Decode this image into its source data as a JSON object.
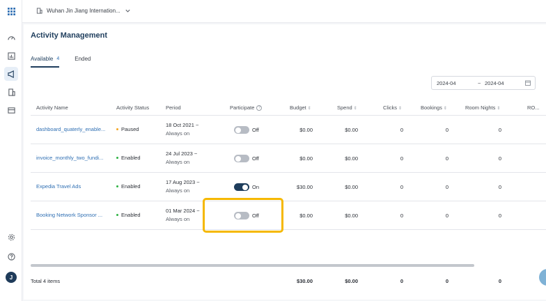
{
  "header": {
    "hotel_name": "Wuhan Jin Jiang Internation..."
  },
  "rail": {
    "avatar_initial": "J"
  },
  "page": {
    "title": "Activity Management"
  },
  "tabs": [
    {
      "label": "Available",
      "count": "4"
    },
    {
      "label": "Ended"
    }
  ],
  "date_range": {
    "start": "2024-04",
    "separator": "~",
    "end": "2024-04"
  },
  "table": {
    "columns": {
      "name": "Activity Name",
      "status": "Activity Status",
      "period": "Period",
      "participate": "Participate",
      "budget": "Budget",
      "spend": "Spend",
      "clicks": "Clicks",
      "bookings": "Bookings",
      "room_nights": "Room Nights",
      "roas": "RO..."
    },
    "rows": [
      {
        "name": "dashboard_quaterly_enable...",
        "status": "Paused",
        "status_color": "#f5a623",
        "period_start": "18 Oct 2021 ~",
        "period_end": "Always on",
        "participate": "Off",
        "budget": "$0.00",
        "spend": "$0.00",
        "clicks": "0",
        "bookings": "0",
        "room_nights": "0"
      },
      {
        "name": "invoice_monthly_two_fundi...",
        "status": "Enabled",
        "status_color": "#2fb344",
        "period_start": "24 Jul 2023 ~",
        "period_end": "Always on",
        "participate": "Off",
        "budget": "$0.00",
        "spend": "$0.00",
        "clicks": "0",
        "bookings": "0",
        "room_nights": "0"
      },
      {
        "name": "Expedia Travel Ads",
        "status": "Enabled",
        "status_color": "#2fb344",
        "period_start": "17 Aug 2023 ~",
        "period_end": "Always on",
        "participate": "On",
        "budget": "$30.00",
        "spend": "$0.00",
        "clicks": "0",
        "bookings": "0",
        "room_nights": "0"
      },
      {
        "name": "Booking Network Sponsor ...",
        "status": "Enabled",
        "status_color": "#2fb344",
        "period_start": "01 Mar 2024 ~",
        "period_end": "Always on",
        "participate": "Off",
        "budget": "$0.00",
        "spend": "$0.00",
        "clicks": "0",
        "bookings": "0",
        "room_nights": "0"
      }
    ],
    "footer": {
      "total_label": "Total 4 items",
      "budget": "$30.00",
      "spend": "$0.00",
      "clicks": "0",
      "bookings": "0",
      "room_nights": "0"
    }
  },
  "colors": {
    "accent": "#1e3d5c",
    "link": "#2f6fb3",
    "highlight": "#f5b800"
  }
}
